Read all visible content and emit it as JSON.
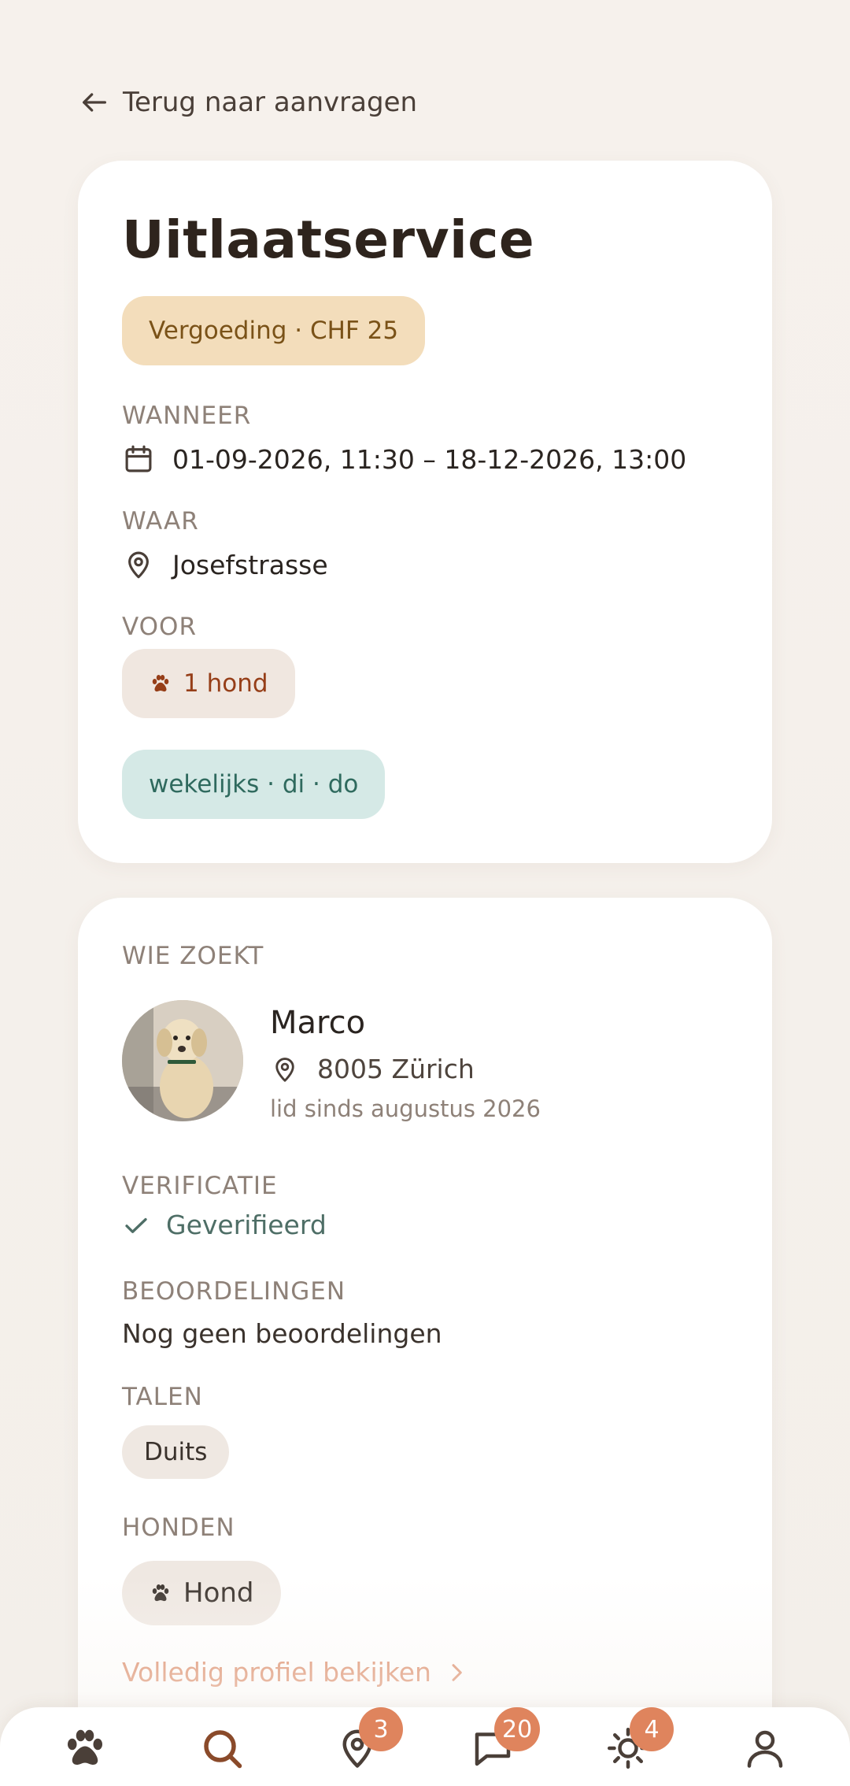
{
  "back_link": {
    "label": "Terug naar aanvragen"
  },
  "request": {
    "title": "Uitlaatservice",
    "fee": "Vergoeding · CHF 25",
    "when_label": "WANNEER",
    "when_value": "01-09-2026, 11:30 – 18-12-2026, 13:00",
    "where_label": "WAAR",
    "where_value": "Josefstrasse",
    "for_label": "VOOR",
    "for_value": "1 hond",
    "frequency": "wekelijks · di · do"
  },
  "requester": {
    "section_label": "WIE ZOEKT",
    "name": "Marco",
    "location": "8005 Zürich",
    "member_since": "lid sinds augustus 2026",
    "verification_label": "VERIFICATIE",
    "verification_value": "Geverifieerd",
    "reviews_label": "BEOORDELINGEN",
    "reviews_value": "Nog geen beoordelingen",
    "languages_label": "TALEN",
    "languages": [
      "Duits"
    ],
    "dogs_label": "HONDEN",
    "dogs": [
      "Hond"
    ],
    "profile_link": "Volledig profiel bekijken"
  },
  "bottom_nav": {
    "items": [
      {
        "icon": "paw-icon",
        "badge": null
      },
      {
        "icon": "search-icon",
        "badge": null
      },
      {
        "icon": "map-pin-icon",
        "badge": "3"
      },
      {
        "icon": "chat-icon",
        "badge": "20"
      },
      {
        "icon": "sun-icon",
        "badge": "4"
      },
      {
        "icon": "user-icon",
        "badge": null
      }
    ]
  },
  "colors": {
    "accent": "#df845d",
    "fee_pill": "#f3ddbb",
    "dog_pill": "#f0e7e0",
    "freq_pill": "#d5e9e6",
    "active_nav": "#8a4a2a"
  }
}
